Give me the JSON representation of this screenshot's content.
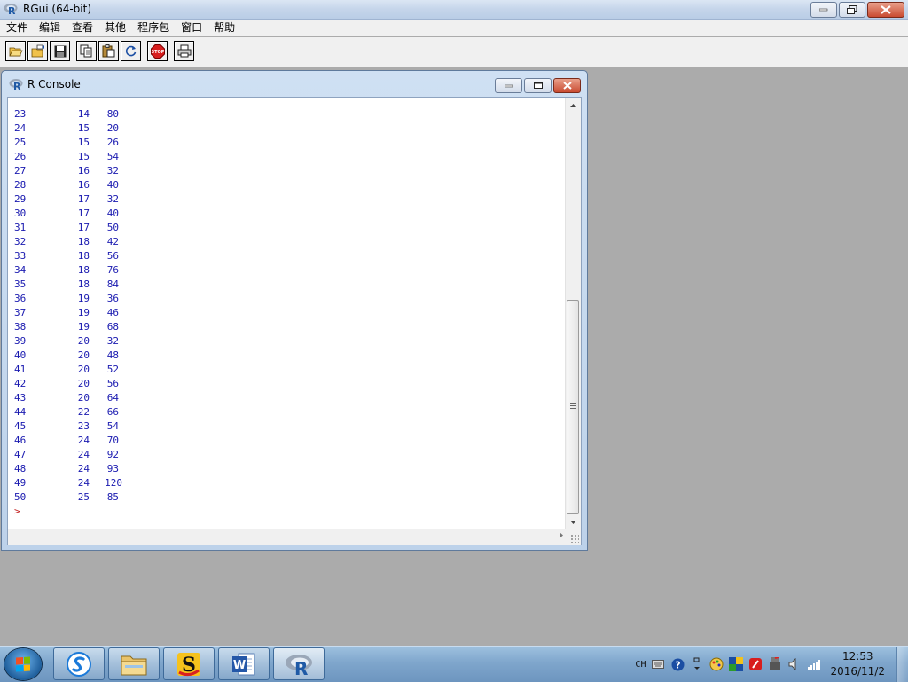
{
  "app": {
    "title": "RGui (64-bit)",
    "icon": "r-logo-icon"
  },
  "menu": [
    "文件",
    "编辑",
    "查看",
    "其他",
    "程序包",
    "窗口",
    "帮助"
  ],
  "toolbar": [
    {
      "name": "open-script-button",
      "icon": "folder-open-icon"
    },
    {
      "name": "load-workspace-button",
      "icon": "load-workspace-icon"
    },
    {
      "name": "save-workspace-button",
      "icon": "floppy-disk-icon"
    },
    {
      "name": "copy-button",
      "icon": "copy-icon"
    },
    {
      "name": "paste-button",
      "icon": "paste-icon"
    },
    {
      "name": "copy-paste-button",
      "icon": "refresh-icon"
    },
    {
      "name": "stop-button",
      "icon": "stop-icon",
      "label": "STOP"
    },
    {
      "name": "print-button",
      "icon": "printer-icon"
    }
  ],
  "console": {
    "title": "R Console",
    "rows": [
      [
        "23",
        "14",
        "80"
      ],
      [
        "24",
        "15",
        "20"
      ],
      [
        "25",
        "15",
        "26"
      ],
      [
        "26",
        "15",
        "54"
      ],
      [
        "27",
        "16",
        "32"
      ],
      [
        "28",
        "16",
        "40"
      ],
      [
        "29",
        "17",
        "32"
      ],
      [
        "30",
        "17",
        "40"
      ],
      [
        "31",
        "17",
        "50"
      ],
      [
        "32",
        "18",
        "42"
      ],
      [
        "33",
        "18",
        "56"
      ],
      [
        "34",
        "18",
        "76"
      ],
      [
        "35",
        "18",
        "84"
      ],
      [
        "36",
        "19",
        "36"
      ],
      [
        "37",
        "19",
        "46"
      ],
      [
        "38",
        "19",
        "68"
      ],
      [
        "39",
        "20",
        "32"
      ],
      [
        "40",
        "20",
        "48"
      ],
      [
        "41",
        "20",
        "52"
      ],
      [
        "42",
        "20",
        "56"
      ],
      [
        "43",
        "20",
        "64"
      ],
      [
        "44",
        "22",
        "66"
      ],
      [
        "45",
        "23",
        "54"
      ],
      [
        "46",
        "24",
        "70"
      ],
      [
        "47",
        "24",
        "92"
      ],
      [
        "48",
        "24",
        "93"
      ],
      [
        "49",
        "24",
        "120"
      ],
      [
        "50",
        "25",
        "85"
      ]
    ],
    "prompt": ">",
    "text_color": "#1a1ab0",
    "prompt_color": "#c21b1b"
  },
  "taskbar": {
    "apps": [
      {
        "name": "sogou-browser-task",
        "icon": "sogou-icon"
      },
      {
        "name": "file-explorer-task",
        "icon": "folder-icon"
      },
      {
        "name": "sogou-input-task",
        "icon": "sogou-s-icon"
      },
      {
        "name": "word-task",
        "icon": "word-icon"
      },
      {
        "name": "rgui-task",
        "icon": "r-logo-icon",
        "active": true
      }
    ],
    "tray": {
      "language": "CH",
      "time": "12:53",
      "date": "2016/11/2"
    }
  }
}
